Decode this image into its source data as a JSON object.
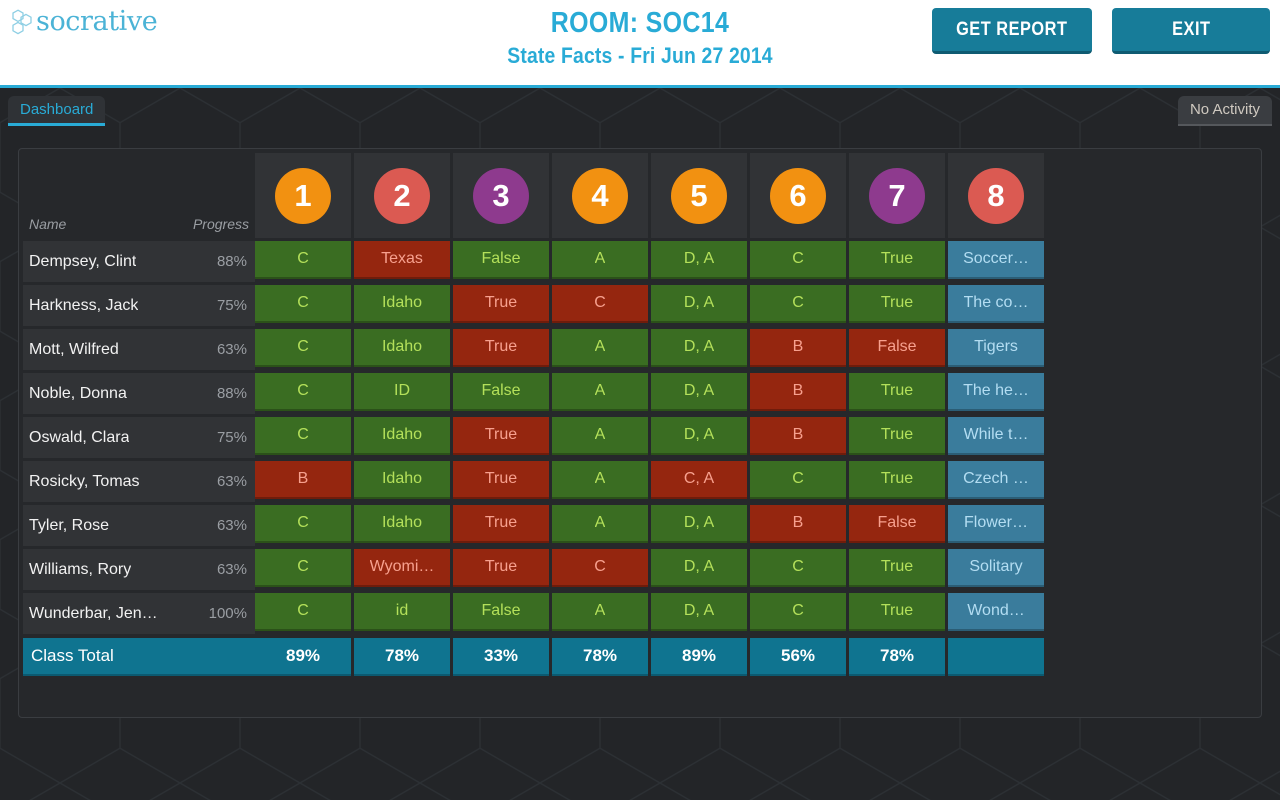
{
  "brand": {
    "name": "socrative",
    "logo_icon": "hexagon-cluster-icon",
    "color": "#4bb3d6"
  },
  "header": {
    "room_title": "ROOM: SOC14",
    "quiz_subtitle": "State Facts - Fri Jun 27 2014",
    "title_color": "#29abd6",
    "buttons": [
      {
        "label": "GET REPORT",
        "name": "get-report-button"
      },
      {
        "label": "EXIT",
        "name": "exit-button"
      }
    ],
    "button_color": "#177c99"
  },
  "navbar": {
    "tab_label": "Dashboard",
    "tab_color": "#29abd6",
    "status_label": "No Activity",
    "status_color": "#cfc9c0"
  },
  "table": {
    "name_header": "Name",
    "progress_header": "Progress",
    "total_label": "Class Total",
    "questions": [
      {
        "number": "1",
        "color": "#f29111"
      },
      {
        "number": "2",
        "color": "#db5a52"
      },
      {
        "number": "3",
        "color": "#8e3a8e"
      },
      {
        "number": "4",
        "color": "#f29111"
      },
      {
        "number": "5",
        "color": "#f29111"
      },
      {
        "number": "6",
        "color": "#f29111"
      },
      {
        "number": "7",
        "color": "#8e3a8e"
      },
      {
        "number": "8",
        "color": "#db5a52"
      }
    ],
    "students": [
      {
        "name": "Dempsey, Clint",
        "progress": "88%",
        "answers": [
          {
            "text": "C",
            "state": "correct"
          },
          {
            "text": "Texas",
            "state": "incorrect"
          },
          {
            "text": "False",
            "state": "correct"
          },
          {
            "text": "A",
            "state": "correct"
          },
          {
            "text": "D, A",
            "state": "correct"
          },
          {
            "text": "C",
            "state": "correct"
          },
          {
            "text": "True",
            "state": "correct"
          },
          {
            "text": "Soccer…",
            "state": "short"
          }
        ]
      },
      {
        "name": "Harkness, Jack",
        "progress": "75%",
        "answers": [
          {
            "text": "C",
            "state": "correct"
          },
          {
            "text": "Idaho",
            "state": "correct"
          },
          {
            "text": "True",
            "state": "incorrect"
          },
          {
            "text": "C",
            "state": "incorrect"
          },
          {
            "text": "D, A",
            "state": "correct"
          },
          {
            "text": "C",
            "state": "correct"
          },
          {
            "text": "True",
            "state": "correct"
          },
          {
            "text": "The co…",
            "state": "short"
          }
        ]
      },
      {
        "name": "Mott, Wilfred",
        "progress": "63%",
        "answers": [
          {
            "text": "C",
            "state": "correct"
          },
          {
            "text": "Idaho",
            "state": "correct"
          },
          {
            "text": "True",
            "state": "incorrect"
          },
          {
            "text": "A",
            "state": "correct"
          },
          {
            "text": "D, A",
            "state": "correct"
          },
          {
            "text": "B",
            "state": "incorrect"
          },
          {
            "text": "False",
            "state": "incorrect"
          },
          {
            "text": "Tigers",
            "state": "short"
          }
        ]
      },
      {
        "name": "Noble, Donna",
        "progress": "88%",
        "answers": [
          {
            "text": "C",
            "state": "correct"
          },
          {
            "text": "ID",
            "state": "correct"
          },
          {
            "text": "False",
            "state": "correct"
          },
          {
            "text": "A",
            "state": "correct"
          },
          {
            "text": "D, A",
            "state": "correct"
          },
          {
            "text": "B",
            "state": "incorrect"
          },
          {
            "text": "True",
            "state": "correct"
          },
          {
            "text": "The he…",
            "state": "short"
          }
        ]
      },
      {
        "name": "Oswald, Clara",
        "progress": "75%",
        "answers": [
          {
            "text": "C",
            "state": "correct"
          },
          {
            "text": "Idaho",
            "state": "correct"
          },
          {
            "text": "True",
            "state": "incorrect"
          },
          {
            "text": "A",
            "state": "correct"
          },
          {
            "text": "D, A",
            "state": "correct"
          },
          {
            "text": "B",
            "state": "incorrect"
          },
          {
            "text": "True",
            "state": "correct"
          },
          {
            "text": "While t…",
            "state": "short"
          }
        ]
      },
      {
        "name": "Rosicky, Tomas",
        "progress": "63%",
        "answers": [
          {
            "text": "B",
            "state": "incorrect"
          },
          {
            "text": "Idaho",
            "state": "correct"
          },
          {
            "text": "True",
            "state": "incorrect"
          },
          {
            "text": "A",
            "state": "correct"
          },
          {
            "text": "C, A",
            "state": "incorrect"
          },
          {
            "text": "C",
            "state": "correct"
          },
          {
            "text": "True",
            "state": "correct"
          },
          {
            "text": "Czech …",
            "state": "short"
          }
        ]
      },
      {
        "name": "Tyler, Rose",
        "progress": "63%",
        "answers": [
          {
            "text": "C",
            "state": "correct"
          },
          {
            "text": "Idaho",
            "state": "correct"
          },
          {
            "text": "True",
            "state": "incorrect"
          },
          {
            "text": "A",
            "state": "correct"
          },
          {
            "text": "D, A",
            "state": "correct"
          },
          {
            "text": "B",
            "state": "incorrect"
          },
          {
            "text": "False",
            "state": "incorrect"
          },
          {
            "text": "Flower…",
            "state": "short"
          }
        ]
      },
      {
        "name": "Williams, Rory",
        "progress": "63%",
        "answers": [
          {
            "text": "C",
            "state": "correct"
          },
          {
            "text": "Wyomi…",
            "state": "incorrect"
          },
          {
            "text": "True",
            "state": "incorrect"
          },
          {
            "text": "C",
            "state": "incorrect"
          },
          {
            "text": "D, A",
            "state": "correct"
          },
          {
            "text": "C",
            "state": "correct"
          },
          {
            "text": "True",
            "state": "correct"
          },
          {
            "text": "Solitary",
            "state": "short"
          }
        ]
      },
      {
        "name": "Wunderbar, Jen…",
        "progress": "100%",
        "answers": [
          {
            "text": "C",
            "state": "correct"
          },
          {
            "text": "id",
            "state": "correct"
          },
          {
            "text": "False",
            "state": "correct"
          },
          {
            "text": "A",
            "state": "correct"
          },
          {
            "text": "D, A",
            "state": "correct"
          },
          {
            "text": "C",
            "state": "correct"
          },
          {
            "text": "True",
            "state": "correct"
          },
          {
            "text": "Wond…",
            "state": "short"
          }
        ]
      }
    ],
    "class_totals": [
      "89%",
      "78%",
      "33%",
      "78%",
      "89%",
      "56%",
      "78%",
      ""
    ],
    "colors": {
      "correct_bg": "#3a6d22",
      "correct_text": "#b4e05a",
      "incorrect_bg": "#95260f",
      "incorrect_text": "#f7a08e",
      "short_bg": "#3a7c9c",
      "short_text": "#b3ddf2",
      "total_bg": "#0f7490"
    }
  }
}
